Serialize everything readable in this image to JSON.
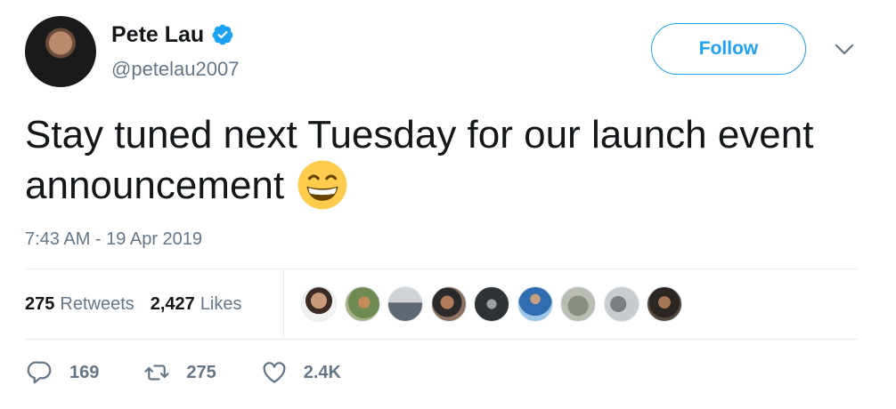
{
  "user": {
    "name": "Pete Lau",
    "handle": "@petelau2007",
    "verified": true,
    "avatar_icon": "profile-photo"
  },
  "header": {
    "follow_label": "Follow",
    "menu_icon": "chevron-down-icon"
  },
  "tweet": {
    "text": "Stay tuned next Tuesday for our launch event announcement",
    "emoji_icon": "grinning-face-emoji",
    "timestamp": "7:43 AM - 19 Apr 2019"
  },
  "stats": {
    "retweets_count": "275",
    "retweets_label": "Retweets",
    "likes_count": "2,427",
    "likes_label": "Likes"
  },
  "actions": {
    "reply_count": "169",
    "retweet_count": "275",
    "like_count": "2.4K"
  },
  "colors": {
    "accent": "#1da1f2",
    "text": "#14171a",
    "secondary": "#657786",
    "divider": "#e6ecf0"
  }
}
